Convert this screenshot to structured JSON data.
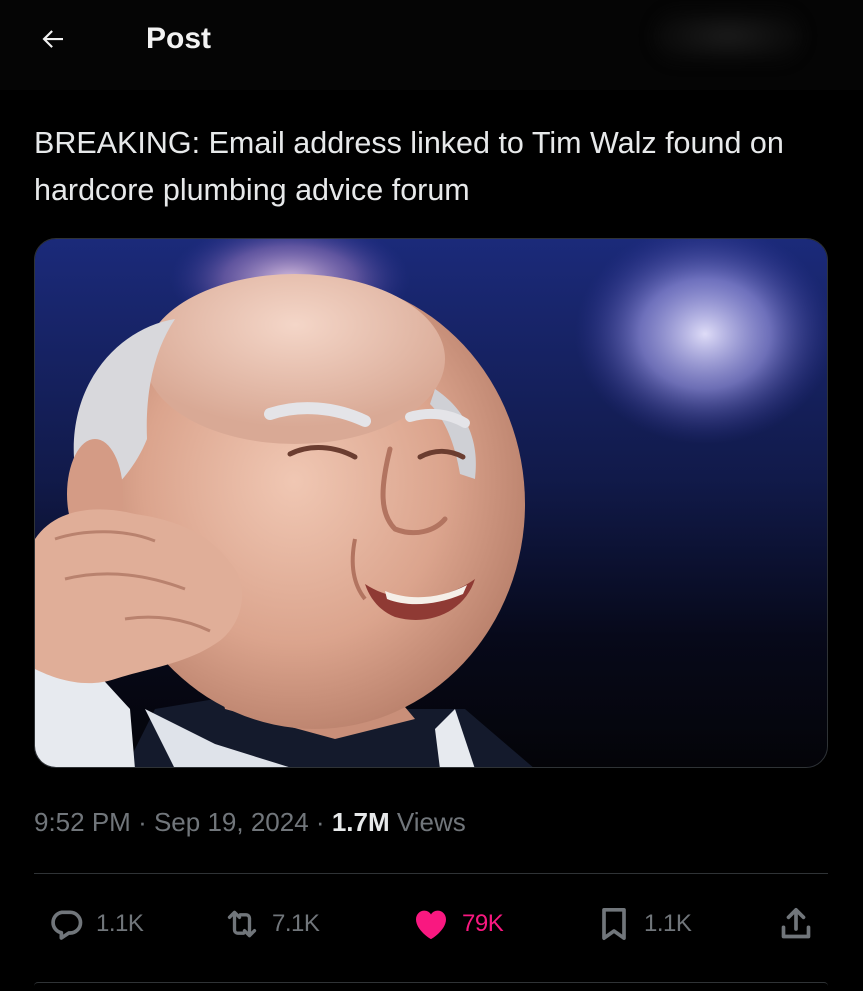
{
  "header": {
    "back_icon": "arrow-left-icon",
    "title": "Post"
  },
  "post": {
    "text": "BREAKING: Email address linked to Tim Walz found on hardcore plumbing advice forum",
    "image_icon": "photo",
    "time": "9:52 PM",
    "separator": "·",
    "date": "Sep 19, 2024",
    "views_count": "1.7M",
    "views_label": "Views"
  },
  "actions": {
    "reply": {
      "icon": "reply-icon",
      "count": "1.1K"
    },
    "repost": {
      "icon": "repost-icon",
      "count": "7.1K"
    },
    "like": {
      "icon": "heart-icon",
      "count": "79K",
      "active": true,
      "color": "#f91880"
    },
    "bookmark": {
      "icon": "bookmark-icon",
      "count": "1.1K"
    },
    "share": {
      "icon": "share-icon"
    }
  },
  "colors": {
    "background": "#000000",
    "text": "#e7e9ea",
    "muted": "#71767b",
    "border": "#2f3336",
    "like": "#f91880"
  }
}
